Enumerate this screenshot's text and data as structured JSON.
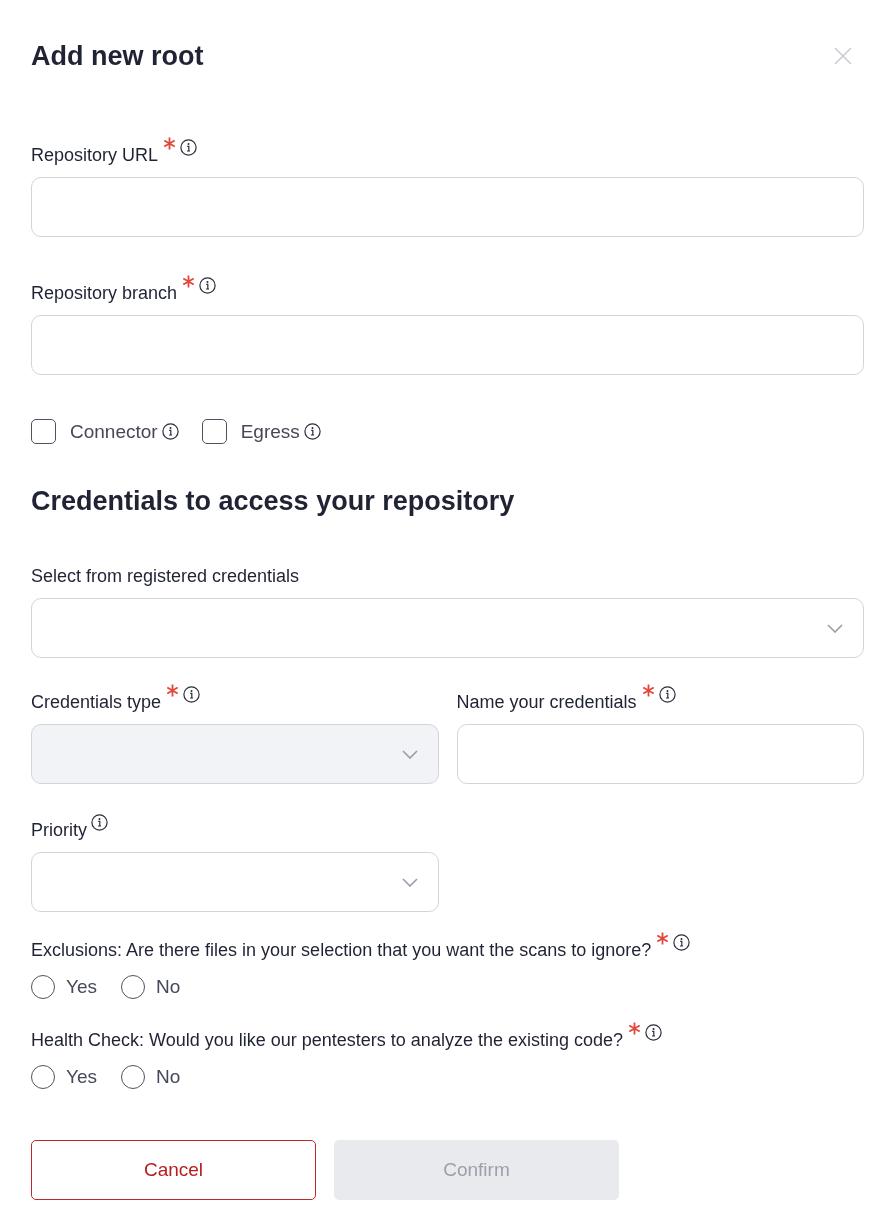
{
  "title": "Add new root",
  "repository_fields": [
    {
      "kind": "input",
      "label": "Repository URL",
      "required": true,
      "info": true,
      "disabled": false
    },
    {
      "kind": "input",
      "label": "Repository branch",
      "required": true,
      "info": true,
      "disabled": false
    }
  ],
  "options": [
    {
      "label": "Connector",
      "checked": false,
      "info": true
    },
    {
      "label": "Egress",
      "checked": false,
      "info": true
    }
  ],
  "credentials": {
    "heading": "Credentials to access your repository",
    "registered": {
      "kind": "select",
      "label": "Select from registered credentials",
      "required": false,
      "info": false,
      "disabled": false
    },
    "type": {
      "kind": "select",
      "label": "Credentials type",
      "required": true,
      "info": true,
      "disabled": true
    },
    "name": {
      "kind": "input",
      "label": "Name your credentials",
      "required": true,
      "info": true,
      "disabled": false
    },
    "priority": {
      "kind": "select",
      "label": "Priority",
      "required": false,
      "info": true,
      "disabled": false
    }
  },
  "questions": [
    {
      "text": "Exclusions: Are there files in your selection that you want the scans to ignore?",
      "required": true,
      "info": true,
      "options": [
        {
          "label": "Yes",
          "selected": false
        },
        {
          "label": "No",
          "selected": false
        }
      ]
    },
    {
      "text": "Health Check: Would you like our pentesters to analyze the existing code?",
      "required": true,
      "info": true,
      "options": [
        {
          "label": "Yes",
          "selected": false
        },
        {
          "label": "No",
          "selected": false
        }
      ]
    }
  ],
  "buttons": [
    {
      "label": "Cancel",
      "kind": "secondary",
      "disabled": false
    },
    {
      "label": "Confirm",
      "kind": "primary",
      "disabled": true
    }
  ]
}
